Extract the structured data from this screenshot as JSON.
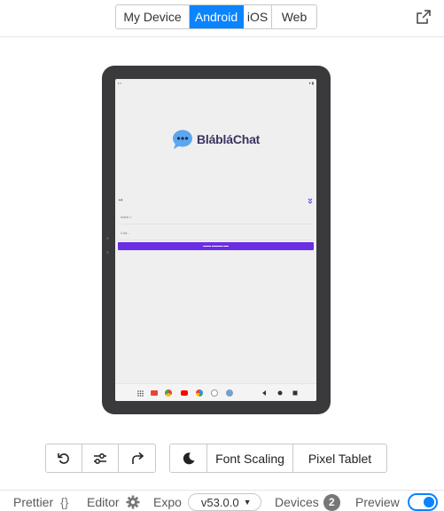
{
  "platform_tabs": [
    {
      "label": "My Device",
      "active": false
    },
    {
      "label": "Android",
      "active": true
    },
    {
      "label": "iOS",
      "active": false
    },
    {
      "label": "Web",
      "active": false
    }
  ],
  "device_screen": {
    "app_name": "BlábláChat",
    "country_code": "+",
    "field_1": "Adult >",
    "field_2": "Cod..."
  },
  "toolbar": {
    "font_scaling_label": "Font Scaling",
    "device_label": "Pixel Tablet"
  },
  "footer": {
    "prettier_label": "Prettier",
    "prettier_icon": "{}",
    "editor_label": "Editor",
    "expo_label": "Expo",
    "expo_version": "v53.0.0",
    "devices_label": "Devices",
    "devices_count": "2",
    "preview_label": "Preview",
    "preview_enabled": true
  },
  "colors": {
    "accent": "#0a84ff",
    "app_button": "#6b2ee6",
    "tablet_frame": "#3a3a3c"
  }
}
